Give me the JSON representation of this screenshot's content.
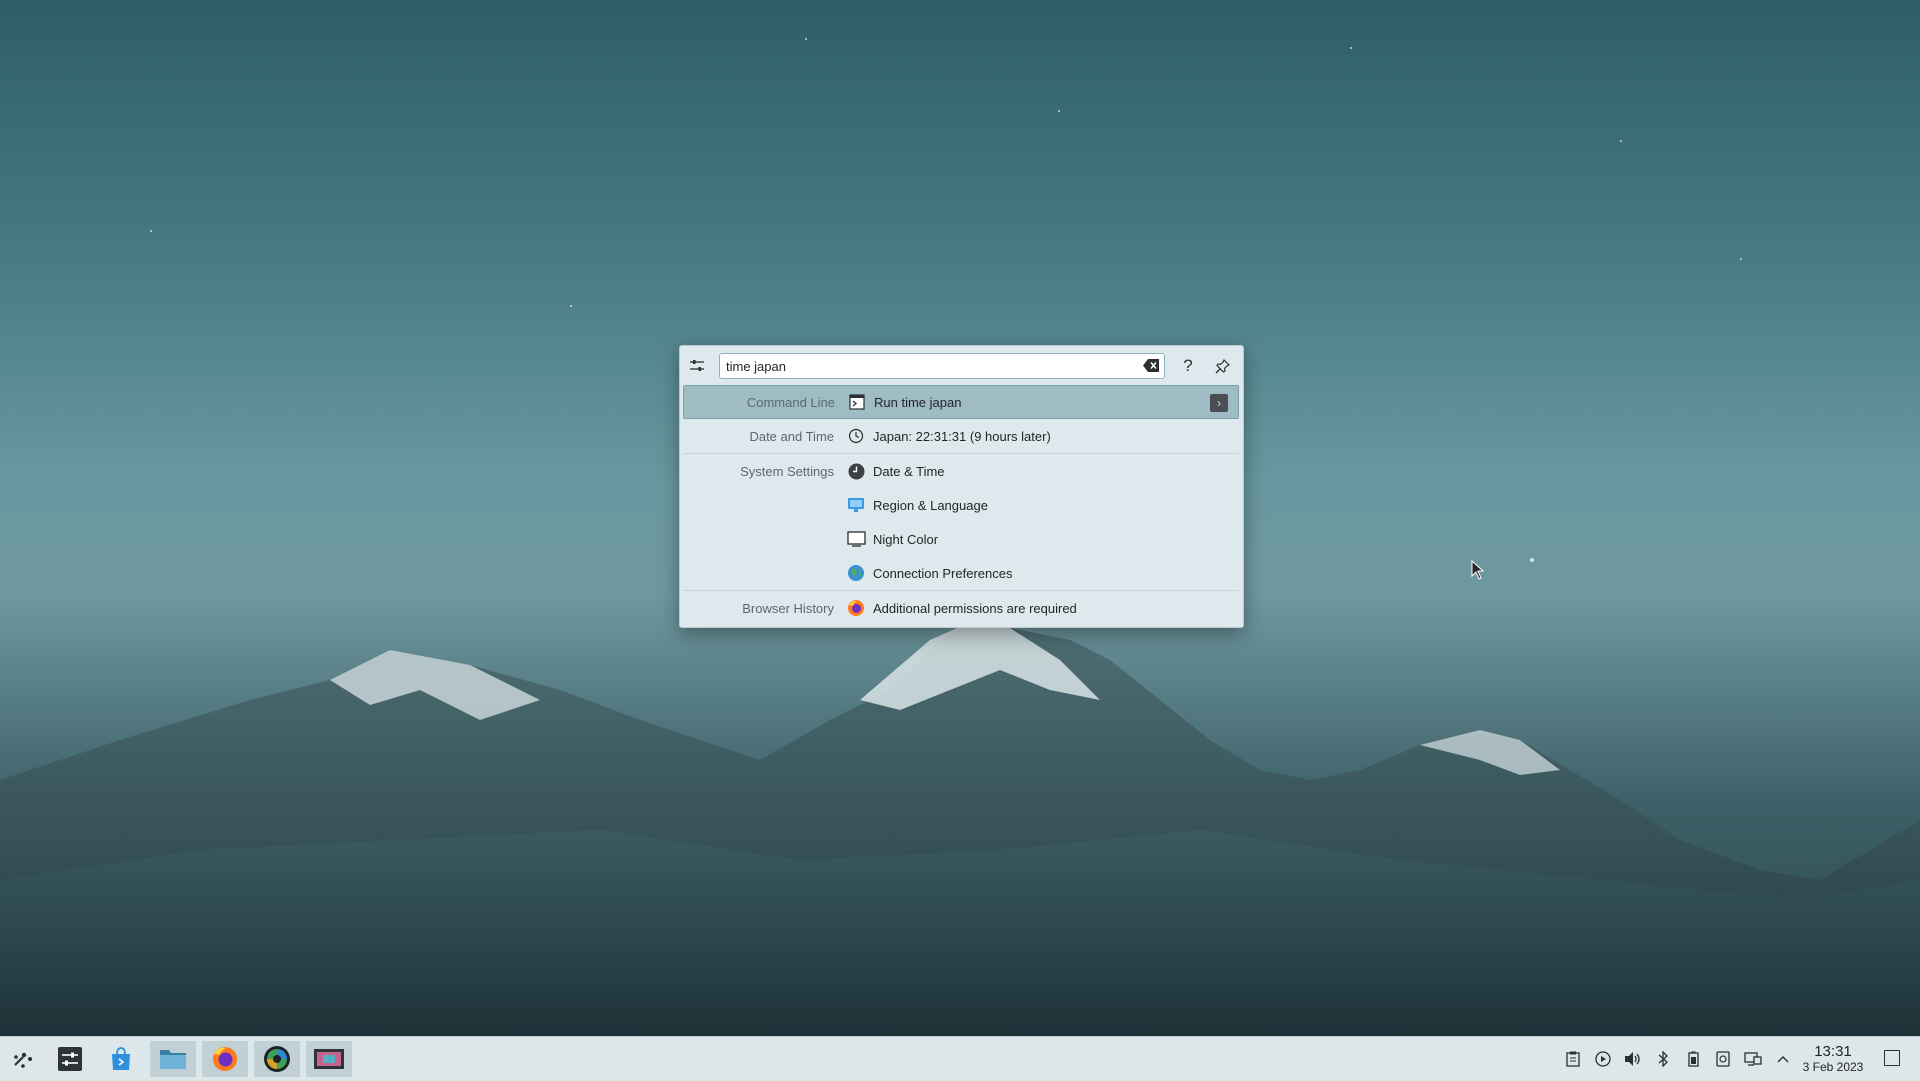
{
  "wallpaper": {
    "description_colors": {
      "sky_top": "#2e5d66",
      "sky_mid": "#6a98a0",
      "mountain": "#223c42",
      "snow": "#e9eef0"
    }
  },
  "krunner": {
    "search": {
      "value": "time japan",
      "placeholder": ""
    },
    "icons": {
      "settings": "settings-sliders-icon",
      "clear": "clear-text-icon",
      "help": "help-icon",
      "pin": "pin-icon"
    },
    "results": [
      {
        "category": "Command Line",
        "icon": "terminal-icon",
        "label": "Run time japan",
        "selected": true
      },
      {
        "category": "Date and Time",
        "icon": "clock-icon",
        "label": "Japan: 22:31:31 (9 hours later)"
      },
      {
        "category": "System Settings",
        "icon": "date-time-icon",
        "label": "Date & Time"
      },
      {
        "category": "",
        "icon": "region-language-icon",
        "label": "Region & Language"
      },
      {
        "category": "",
        "icon": "night-color-icon",
        "label": "Night Color"
      },
      {
        "category": "",
        "icon": "connection-preferences-icon",
        "label": "Connection Preferences"
      },
      {
        "category": "Browser History",
        "icon": "firefox-icon",
        "label": "Additional permissions are required"
      }
    ],
    "accent": "#9fbcc4"
  },
  "taskbar": {
    "apps": [
      {
        "name": "application-launcher"
      },
      {
        "name": "system-settings"
      },
      {
        "name": "discover"
      },
      {
        "name": "dolphin-file-manager"
      },
      {
        "name": "firefox"
      },
      {
        "name": "color-picker-app"
      },
      {
        "name": "screenshot-app"
      }
    ],
    "tray": [
      "clipboard-icon",
      "media-player-icon",
      "volume-icon",
      "bluetooth-icon",
      "battery-icon",
      "disks-icon",
      "network-icon",
      "expand-tray-icon"
    ],
    "clock": {
      "time": "13:31",
      "date": "3 Feb 2023"
    }
  }
}
